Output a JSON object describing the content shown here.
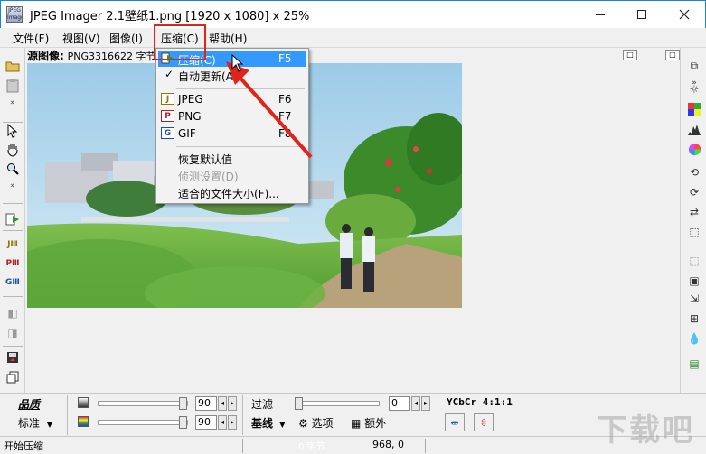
{
  "window": {
    "title": "JPEG Imager 2.1壁纸1.png [1920 x 1080] x 25%",
    "app_icon_text": "JPEG Imager",
    "minimize_icon": "minimize-icon",
    "maximize_icon": "maximize-icon",
    "close_icon": "close-icon"
  },
  "menubar": {
    "items": [
      {
        "label": "文件(F)"
      },
      {
        "label": "视图(V)"
      },
      {
        "label": "图像(I)"
      },
      {
        "label": "压缩(C)"
      },
      {
        "label": "帮助(H)"
      }
    ],
    "right_button": "□"
  },
  "source_line": {
    "label": "源图像:",
    "value": "PNG3316622 字节"
  },
  "compress_menu": {
    "items": [
      {
        "label": "压缩(C)",
        "shortcut": "F5",
        "icon": "compress-icon",
        "selected": true
      },
      {
        "label": "自动更新(A)",
        "shortcut": "",
        "icon": "checkmark-icon",
        "checked": true
      },
      {
        "label": "JPEG",
        "shortcut": "F6",
        "icon": "jpeg-format-icon",
        "icon_text": "J"
      },
      {
        "label": "PNG",
        "shortcut": "F7",
        "icon": "png-format-icon",
        "icon_text": "P"
      },
      {
        "label": "GIF",
        "shortcut": "F8",
        "icon": "gif-format-icon",
        "icon_text": "G"
      },
      {
        "label": "恢复默认值",
        "shortcut": ""
      },
      {
        "label": "侦测设置(D)",
        "shortcut": "",
        "disabled": true
      },
      {
        "label": "适合的文件大小(F)...",
        "shortcut": ""
      }
    ]
  },
  "bottom_panel": {
    "quality_label": "品质",
    "standard_label": "标准",
    "slider1_value": "90",
    "slider2_value": "90",
    "filter_label": "过滤",
    "filter_value": "0",
    "subsampling_label": "YCbCr 4:1:1",
    "baseline_label": "基线",
    "options_label": "选项",
    "extra_label": "额外"
  },
  "statusbar": {
    "message": "开始压缩",
    "size": "0 字节",
    "coords": "968, 0"
  },
  "watermark": {
    "text": "下载吧"
  },
  "colors": {
    "highlight_box": "#e2231a",
    "selection": "#3399ff",
    "arrow": "#e2231a",
    "title_border": "#1883d7"
  }
}
